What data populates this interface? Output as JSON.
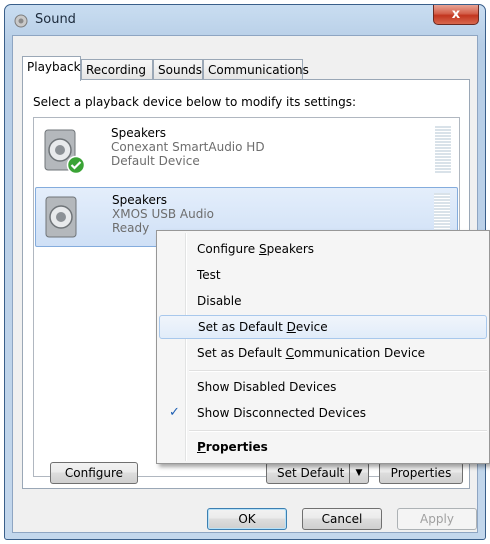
{
  "window": {
    "title": "Sound",
    "close_label": "x"
  },
  "tabs": [
    {
      "label": "Playback"
    },
    {
      "label": "Recording"
    },
    {
      "label": "Sounds"
    },
    {
      "label": "Communications"
    }
  ],
  "instruction": "Select a playback device below to modify its settings:",
  "devices": [
    {
      "name": "Speakers",
      "driver": "Conexant SmartAudio HD",
      "status": "Default Device"
    },
    {
      "name": "Speakers",
      "driver": "XMOS USB Audio",
      "status": "Ready"
    }
  ],
  "context_menu": {
    "configure_pre": "Configure ",
    "configure_u": "S",
    "configure_post": "peakers",
    "test": "Test",
    "disable": "Disable",
    "default_pre": "Set as Default ",
    "default_u": "D",
    "default_post": "evice",
    "comm_pre": "Set as Default ",
    "comm_u": "C",
    "comm_post": "ommunication Device",
    "show_disabled": "Show Disabled Devices",
    "show_disconnected": "Show Disconnected Devices",
    "check": "✓",
    "props_u": "P",
    "props_post": "roperties"
  },
  "buttons": {
    "configure": "Configure",
    "set_default": "Set Default",
    "properties": "Properties",
    "ok": "OK",
    "cancel": "Cancel",
    "apply": "Apply"
  },
  "colors": {
    "accent": "#3c7fb1",
    "check_green": "#3aa335",
    "close_red": "#c2351f"
  }
}
